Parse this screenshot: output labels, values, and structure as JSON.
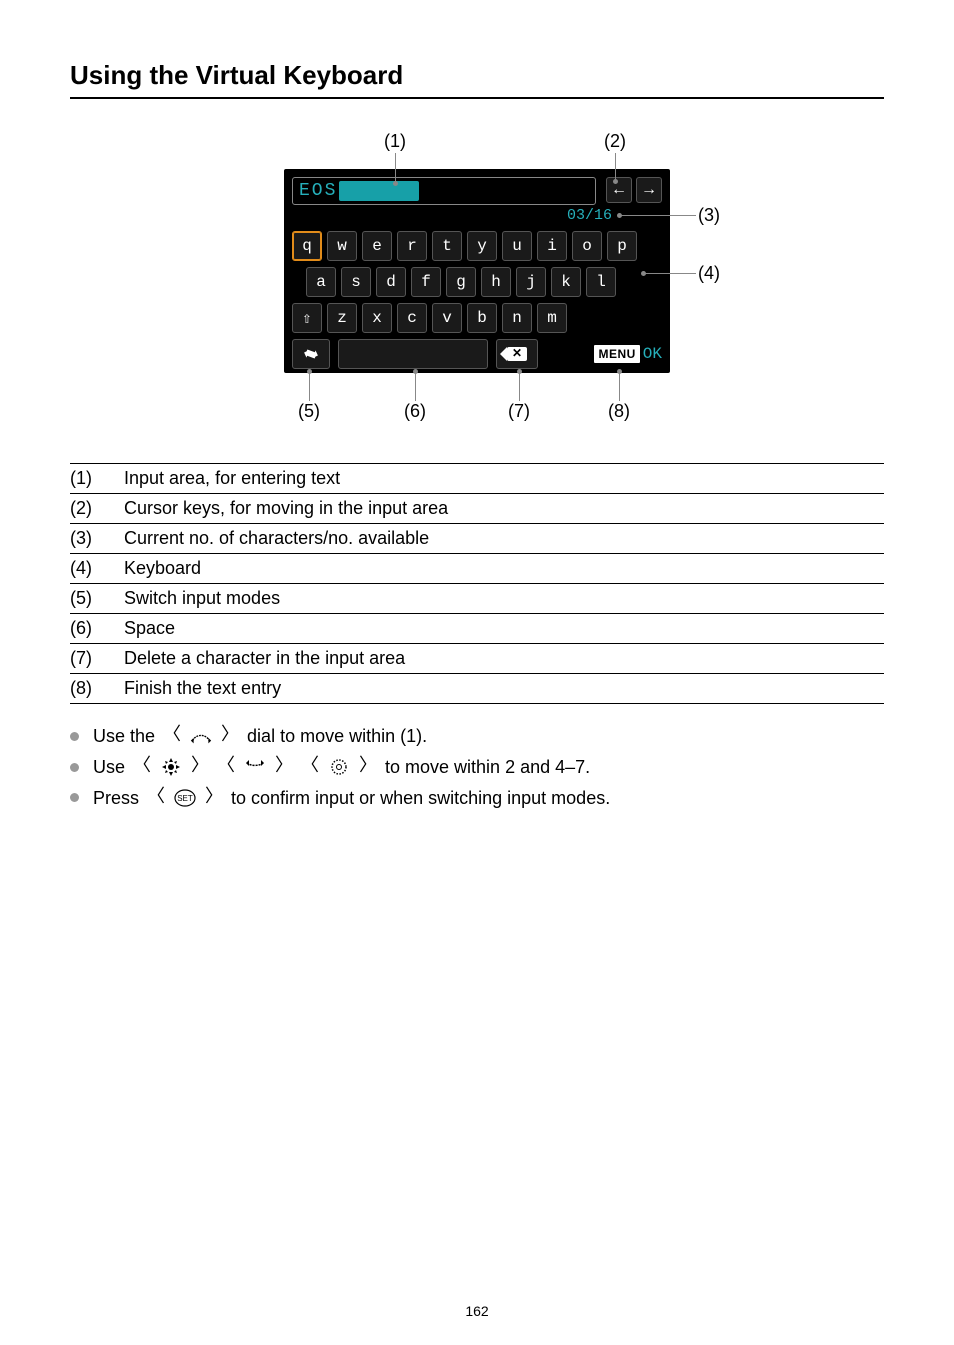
{
  "title": "Using the Virtual Keyboard",
  "screen": {
    "input_text": "EOS",
    "char_count": "03/16",
    "ok_label": "OK",
    "menu_label": "MENU",
    "rows": {
      "r1": [
        "q",
        "w",
        "e",
        "r",
        "t",
        "y",
        "u",
        "i",
        "o",
        "p"
      ],
      "r2": [
        "a",
        "s",
        "d",
        "f",
        "g",
        "h",
        "j",
        "k",
        "l"
      ],
      "r3_shift": "⇧",
      "r3": [
        "z",
        "x",
        "c",
        "v",
        "b",
        "n",
        "m"
      ]
    }
  },
  "callouts": {
    "c1": "(1)",
    "c2": "(2)",
    "c3": "(3)",
    "c4": "(4)",
    "c5": "(5)",
    "c6": "(6)",
    "c7": "(7)",
    "c8": "(8)"
  },
  "legend": [
    {
      "n": "(1)",
      "t": "Input area, for entering text"
    },
    {
      "n": "(2)",
      "t": "Cursor keys, for moving in the input area"
    },
    {
      "n": "(3)",
      "t": "Current no. of characters/no. available"
    },
    {
      "n": "(4)",
      "t": "Keyboard"
    },
    {
      "n": "(5)",
      "t": "Switch input modes"
    },
    {
      "n": "(6)",
      "t": "Space"
    },
    {
      "n": "(7)",
      "t": "Delete a character in the input area"
    },
    {
      "n": "(8)",
      "t": "Finish the text entry"
    }
  ],
  "bullets": {
    "b1_a": "Use the ",
    "b1_b": " dial to move within (1).",
    "b2_a": "Use ",
    "b2_b": " to move within 2 and 4–7.",
    "b3_a": "Press ",
    "b3_b": " to confirm input or when switching input modes."
  },
  "icons": {
    "main_dial": "main-dial",
    "multi": "multi-controller",
    "qcd": "quick-control-dial-1",
    "qcd2": "quick-control-dial-2",
    "set": "SET"
  },
  "page_number": "162"
}
